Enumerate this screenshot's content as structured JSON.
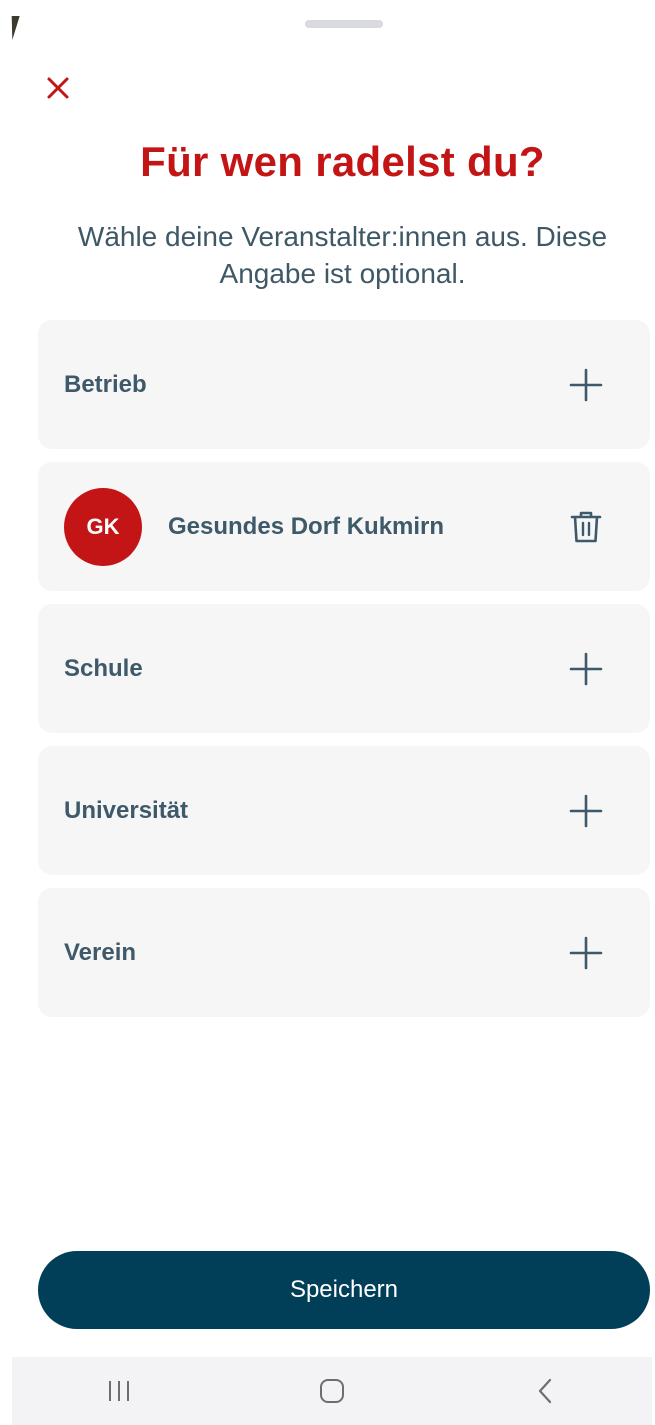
{
  "header": {
    "title": "Für wen radelst du?",
    "subtitle": "Wähle deine Veranstalter:innen aus. Diese Angabe ist optional."
  },
  "colors": {
    "accent_red": "#c41516",
    "primary_dark": "#003f57",
    "label_text": "#3e5a6a",
    "card_bg": "#f6f6f7"
  },
  "organizers": [
    {
      "label": "Betrieb",
      "action_icon": "plus-icon"
    },
    {
      "label": "Gesundes Dorf Kukmirn",
      "initials": "GK",
      "action_icon": "trash-icon"
    },
    {
      "label": "Schule",
      "action_icon": "plus-icon"
    },
    {
      "label": "Universität",
      "action_icon": "plus-icon"
    },
    {
      "label": "Verein",
      "action_icon": "plus-icon"
    }
  ],
  "footer": {
    "save_label": "Speichern"
  }
}
